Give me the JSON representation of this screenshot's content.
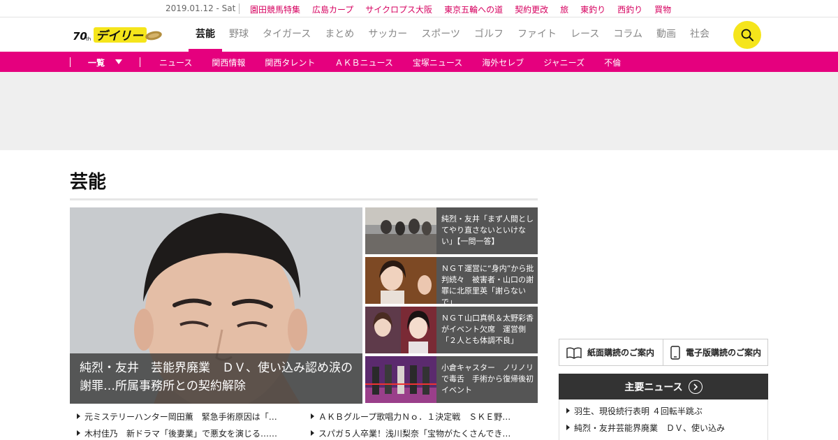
{
  "topbar": {
    "date": "2019.01.12 - Sat",
    "links": [
      "園田競馬特集",
      "広島カープ",
      "サイクロプス大阪",
      "東京五輪への道",
      "契約更改",
      "旅",
      "東釣り",
      "西釣り",
      "買物"
    ]
  },
  "header": {
    "logo_text": "デイリー",
    "nav": [
      "芸能",
      "野球",
      "タイガース",
      "まとめ",
      "サッカー",
      "スポーツ",
      "ゴルフ",
      "ファイト",
      "レース",
      "コラム",
      "動画",
      "社会"
    ],
    "active_index": 0
  },
  "subnav": {
    "menu_label": "一覧",
    "links": [
      "ニュース",
      "関西情報",
      "関西タレント",
      "ＡＫＢニュース",
      "宝塚ニュース",
      "海外セレブ",
      "ジャニーズ",
      "不倫"
    ]
  },
  "section": {
    "title": "芸能"
  },
  "hero": {
    "caption": "純烈・友井　芸能界廃業　ＤＶ、使い込み認め涙の謝罪…所属事務所との契約解除"
  },
  "side_stories": [
    {
      "text": "純烈・友井「まず人間としてやり直さないといけない」【一問一答】"
    },
    {
      "text": "ＮＧＴ運営に“身内”から批判続々　被害者・山口の謝罪に北原里英「謝らないで」"
    },
    {
      "text": "ＮＧＴ山口真帆＆太野彩香がイベント欠席　運営側「２人とも体調不良」"
    },
    {
      "text": "小倉キャスター　ノリノリで毒舌　手術から復帰後初イベント"
    }
  ],
  "bottom_list": {
    "left": [
      "元ミステリーハンター岡田薫　緊急手術原因は「…",
      "木村佳乃　新ドラマ「後妻業」で悪女を演じる……"
    ],
    "right": [
      "ＡＫＢグループ歌唱力Ｎｏ．１決定戦　ＳＫＥ野…",
      "スパガ５人卒業！浅川梨奈「宝物がたくさんでき…"
    ]
  },
  "sidebar": {
    "paper_subscription": "紙面購読のご案内",
    "digital_subscription": "電子版購読のご案内",
    "major_news_title": "主要ニュース",
    "major_news": [
      "羽生、現役続行表明 ４回転半跳ぶ",
      "純烈・友井芸能界廃業　ＤＶ、使い込み"
    ]
  },
  "colors": {
    "brand_pink": "#e5007e",
    "search_yellow": "#f5e51b",
    "toplink_red": "#d6005f"
  }
}
